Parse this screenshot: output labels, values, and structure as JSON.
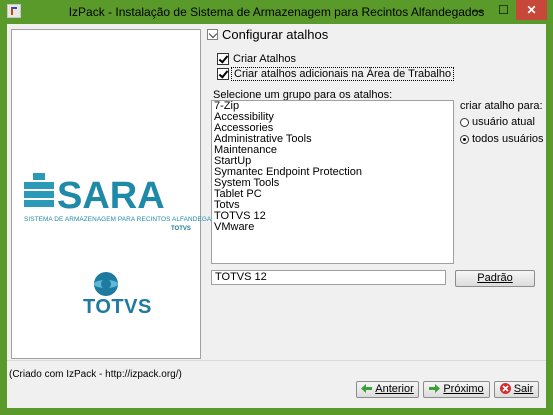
{
  "window": {
    "title": "IzPack - Instalação de Sistema de Armazenagem para Recintos Alfandegados",
    "min_glyph": "—",
    "max_glyph": "☐",
    "close_glyph": "✕"
  },
  "branding": {
    "sara_name": "SARA",
    "sara_subtitle": "SISTEMA DE ARMAZENAGEM PARA RECINTOS ALFANDEGADOS",
    "sara_small_brand": "TOTVS",
    "totvs_name": "TOTVS"
  },
  "panel": {
    "header": "Configurar atalhos",
    "create_shortcuts_label": "Criar Atalhos",
    "create_shortcuts_checked": true,
    "desktop_shortcuts_label": "Criar atalhos adicionais na Área de Trabalho",
    "desktop_shortcuts_checked": true,
    "group_label": "Selecione um grupo para os atalhos:",
    "groups": [
      "7-Zip",
      "Accessibility",
      "Accessories",
      "Administrative Tools",
      "Maintenance",
      "StartUp",
      "Symantec Endpoint Protection",
      "System Tools",
      "Tablet PC",
      "Totvs",
      "TOTVS 12",
      "VMware"
    ],
    "target_label": "criar atalho para:",
    "target_options": [
      "usuário atual",
      "todos usuários"
    ],
    "target_selected": "todos usuários",
    "group_value": "TOTVS 12",
    "default_button": "Padrão"
  },
  "footer": {
    "credit": "(Criado com IzPack - http://izpack.org/)",
    "back_button": "Anterior",
    "next_button": "Próximo",
    "quit_button": "Sair"
  },
  "colors": {
    "titlebar": "#5a9a2a",
    "close": "#c7473a",
    "brand_teal": "#1f8aa8",
    "totvs_blue": "#1f7aa0"
  }
}
